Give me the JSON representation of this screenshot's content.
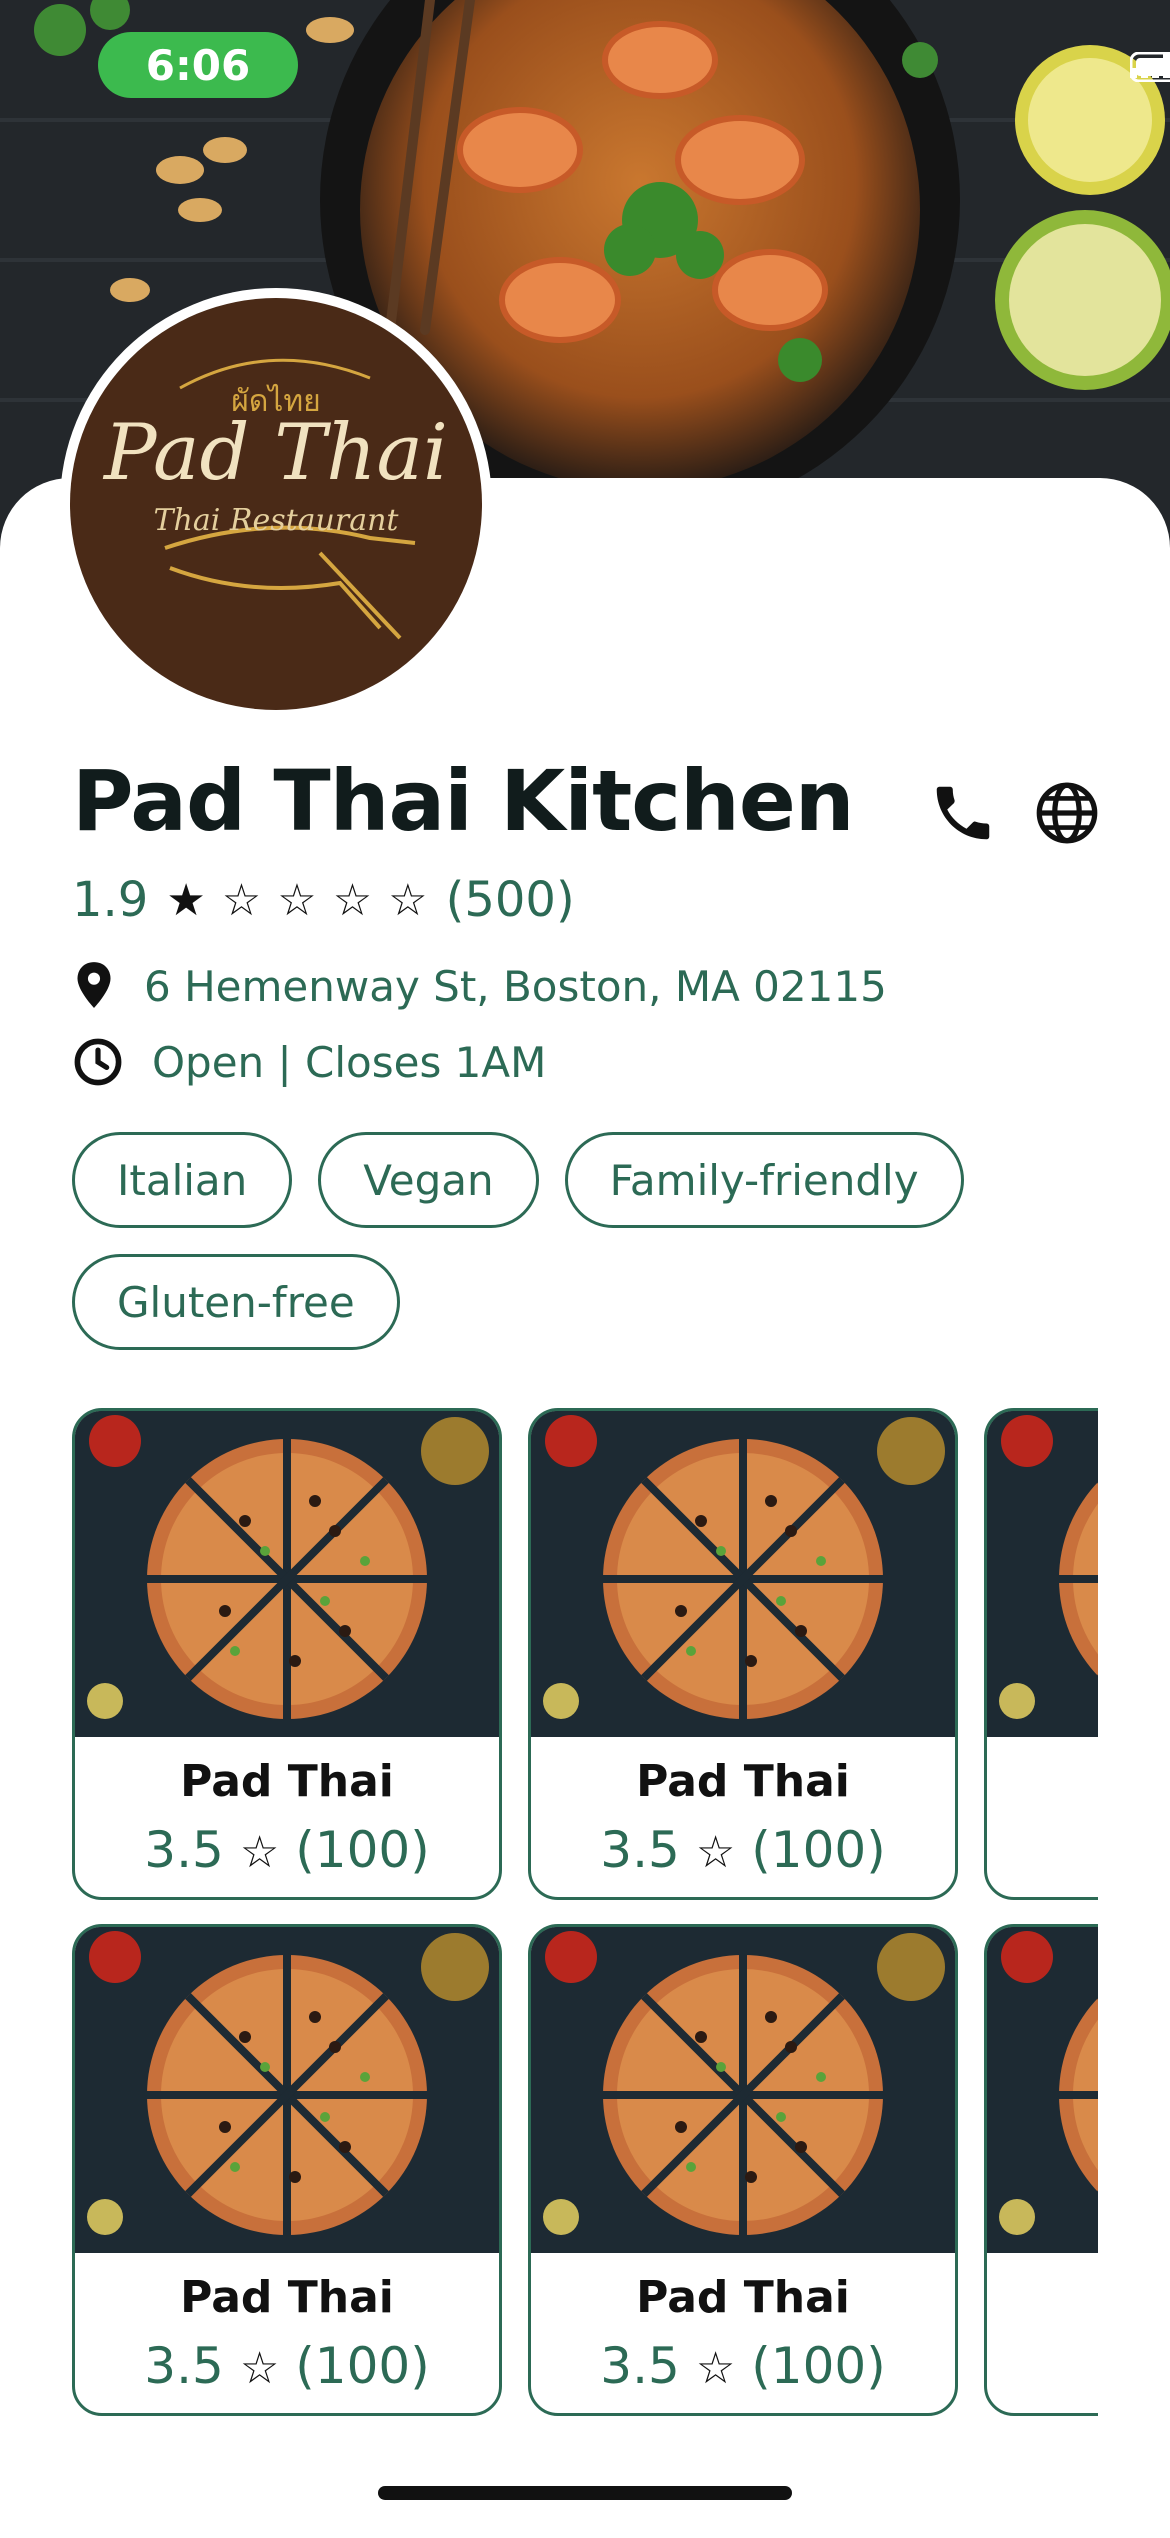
{
  "status_bar": {
    "time": "6:06"
  },
  "restaurant": {
    "logo": {
      "thai_text": "ผัดไทย",
      "main_text": "Pad Thai",
      "sub_text": "Thai Restaurant"
    },
    "name": "Pad Thai Kitchen",
    "rating": "1.9",
    "stars_filled": 1,
    "stars_total": 5,
    "review_count": "(500)",
    "address": "6 Hemenway St, Boston, MA 02115",
    "hours": "Open | Closes 1AM",
    "tags": [
      "Italian",
      "Vegan",
      "Family-friendly",
      "Gluten-free"
    ]
  },
  "icons": {
    "phone": "phone-icon",
    "website": "globe-icon",
    "location": "location-pin-icon",
    "clock": "clock-icon"
  },
  "menu_items": [
    {
      "name": "Pad Thai",
      "rating": "3.5",
      "count": "(100)"
    },
    {
      "name": "Pad Thai",
      "rating": "3.5",
      "count": "(100)"
    },
    {
      "name": "Pad Thai",
      "rating": "3.5",
      "count": "(100)"
    },
    {
      "name": "Pad Thai",
      "rating": "3.5",
      "count": "(100)"
    }
  ],
  "colors": {
    "accent": "#2c6a55",
    "status_pill": "#3cba4e",
    "logo_bg": "#4a2a17"
  }
}
